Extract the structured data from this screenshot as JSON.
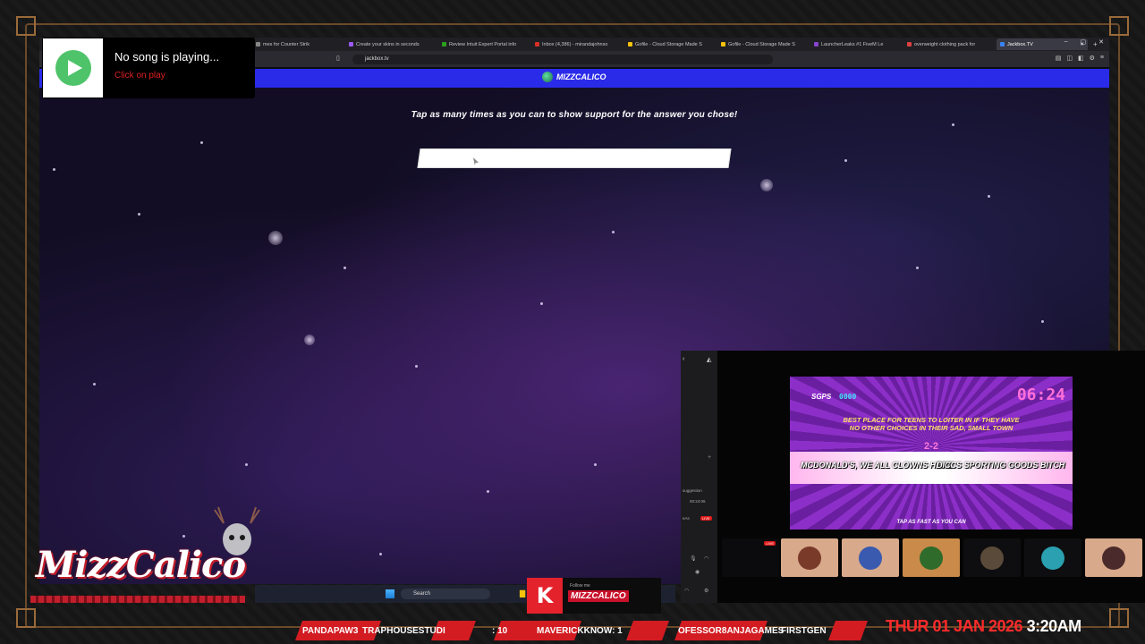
{
  "song_widget": {
    "title": "No song is playing...",
    "subtitle": "Click on play"
  },
  "browser": {
    "tabs": [
      {
        "label": "mes for Counter Strik"
      },
      {
        "label": "Create your skins in seconds"
      },
      {
        "label": "Review Intuit Expert Portal info"
      },
      {
        "label": "Inbox (4,386) - mirandajohnso"
      },
      {
        "label": "Gofile - Cloud Storage Made S"
      },
      {
        "label": "Gofile - Cloud Storage Made S"
      },
      {
        "label": "LauncherLeaks #1 FiveM Le"
      },
      {
        "label": "overweight clothing pack for"
      },
      {
        "label": "Jackbox.TV"
      }
    ],
    "url": "jackbox.tv"
  },
  "site": {
    "logo_text": "MIZZCALICO",
    "prompt": "Tap as many times as you can to show support for the answer you chose!"
  },
  "overlay": {
    "side_panel": {
      "suggestion": "suggestion",
      "timer": "00:24:06",
      "user": "eAs",
      "live_badge": "LIVE"
    },
    "game": {
      "score_label": "SGPS",
      "score_value": "0000",
      "timer": "06:24",
      "question_line1": "BEST PLACE FOR TEENS TO LOITER IN IF THEY HAVE",
      "question_line2": "NO OTHER CHOICES IN THEIR SAD, SMALL TOWN",
      "tally": "2-2",
      "answer_a": "MCDONALD'S, WE ALL CLOWNS HERE",
      "answer_b": "DICCS SPORTING GOODS BITCH",
      "footer": "TAP AS FAST AS YOU CAN"
    },
    "avatar_live": "LIVE"
  },
  "taskbar": {
    "search_placeholder": "Search"
  },
  "kick": {
    "letter": "K",
    "follow_label": "Follow me",
    "channel": "MIZZCALICO"
  },
  "brand": {
    "name": "MizzCalico"
  },
  "ticker": {
    "items": [
      "PANDAPAW3",
      "TRAPHOUSESTUDI",
      ": 10",
      "MAVERICKKNOW: 1",
      "OFESSOR8ANJAGAMES",
      "FIRSTGEN"
    ],
    "date": "THUR 01 JAN 2026",
    "time": "3:20AM"
  },
  "colors": {
    "site_bar": "#2a2be8",
    "kick_red": "#e4222c",
    "song_green": "#4fc36a",
    "ticker_red": "#d21c22"
  }
}
